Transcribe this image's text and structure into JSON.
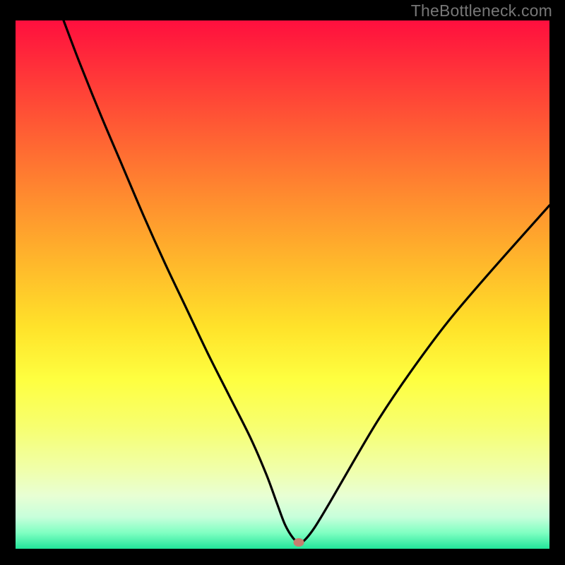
{
  "watermark": "TheBottleneck.com",
  "chart_data": {
    "type": "line",
    "title": "",
    "xlabel": "",
    "ylabel": "",
    "xlim": [
      0,
      100
    ],
    "ylim": [
      0,
      100
    ],
    "grid": false,
    "series": [
      {
        "name": "bottleneck-curve",
        "x": [
          9,
          12,
          16,
          20,
          24,
          28,
          32,
          36,
          40,
          44,
          47,
          49,
          50.5,
          52,
          53,
          54,
          56,
          59,
          63,
          68,
          74,
          81,
          89,
          100
        ],
        "y": [
          100,
          92,
          82,
          72.5,
          63,
          54,
          45.5,
          37,
          29,
          21,
          14,
          8.5,
          4.5,
          2,
          1.3,
          1.5,
          4,
          9,
          16,
          24.5,
          33.5,
          43,
          52.5,
          65
        ]
      }
    ],
    "marker": {
      "x": 53,
      "y": 1.2,
      "color": "#c77e6e"
    },
    "background_gradient": {
      "top": "#ff0f3e",
      "middle": "#ffe22a",
      "bottom": "#22e59a"
    }
  }
}
